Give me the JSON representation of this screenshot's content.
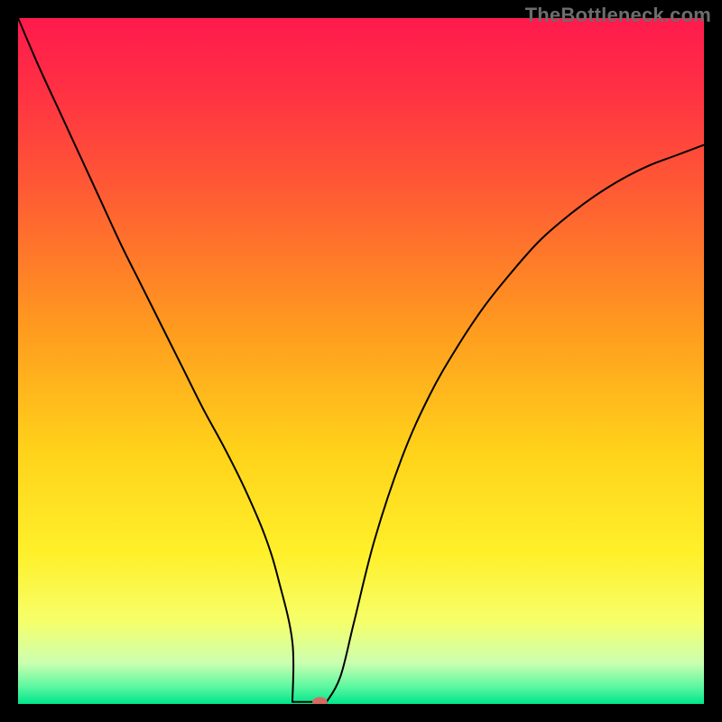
{
  "watermark": "TheBottleneck.com",
  "colors": {
    "gradient_stops": [
      {
        "offset": 0.0,
        "color": "#ff1a4d"
      },
      {
        "offset": 0.1,
        "color": "#ff2f44"
      },
      {
        "offset": 0.25,
        "color": "#ff5a34"
      },
      {
        "offset": 0.45,
        "color": "#ff9a1f"
      },
      {
        "offset": 0.63,
        "color": "#ffd21a"
      },
      {
        "offset": 0.78,
        "color": "#fff02a"
      },
      {
        "offset": 0.88,
        "color": "#f6ff6a"
      },
      {
        "offset": 0.94,
        "color": "#ccffb0"
      },
      {
        "offset": 0.975,
        "color": "#5cf7a0"
      },
      {
        "offset": 1.0,
        "color": "#00e58a"
      }
    ],
    "curve": "#000000",
    "marker": "#d66a62",
    "frame": "#000000"
  },
  "chart_data": {
    "type": "line",
    "title": "",
    "xlabel": "",
    "ylabel": "",
    "xlim": [
      0,
      100
    ],
    "ylim": [
      0,
      100
    ],
    "flat_range": [
      40,
      45
    ],
    "marker": {
      "x": 45,
      "y": 99
    },
    "series": [
      {
        "name": "bottleneck",
        "x": [
          0,
          3,
          6,
          9,
          12,
          15,
          18,
          21,
          24,
          27,
          30,
          33,
          36,
          38,
          40,
          42,
          44,
          45,
          47,
          49,
          52,
          56,
          60,
          64,
          68,
          72,
          76,
          80,
          84,
          88,
          92,
          96,
          100
        ],
        "y": [
          100,
          93,
          86.5,
          80,
          73.5,
          67,
          61,
          55,
          49,
          43,
          37.5,
          31.5,
          24.5,
          18,
          9,
          2,
          0.6,
          0.3,
          4,
          12,
          24,
          36,
          45,
          52,
          58,
          63,
          67.5,
          71,
          74,
          76.5,
          78.5,
          80,
          81.5
        ]
      }
    ]
  }
}
